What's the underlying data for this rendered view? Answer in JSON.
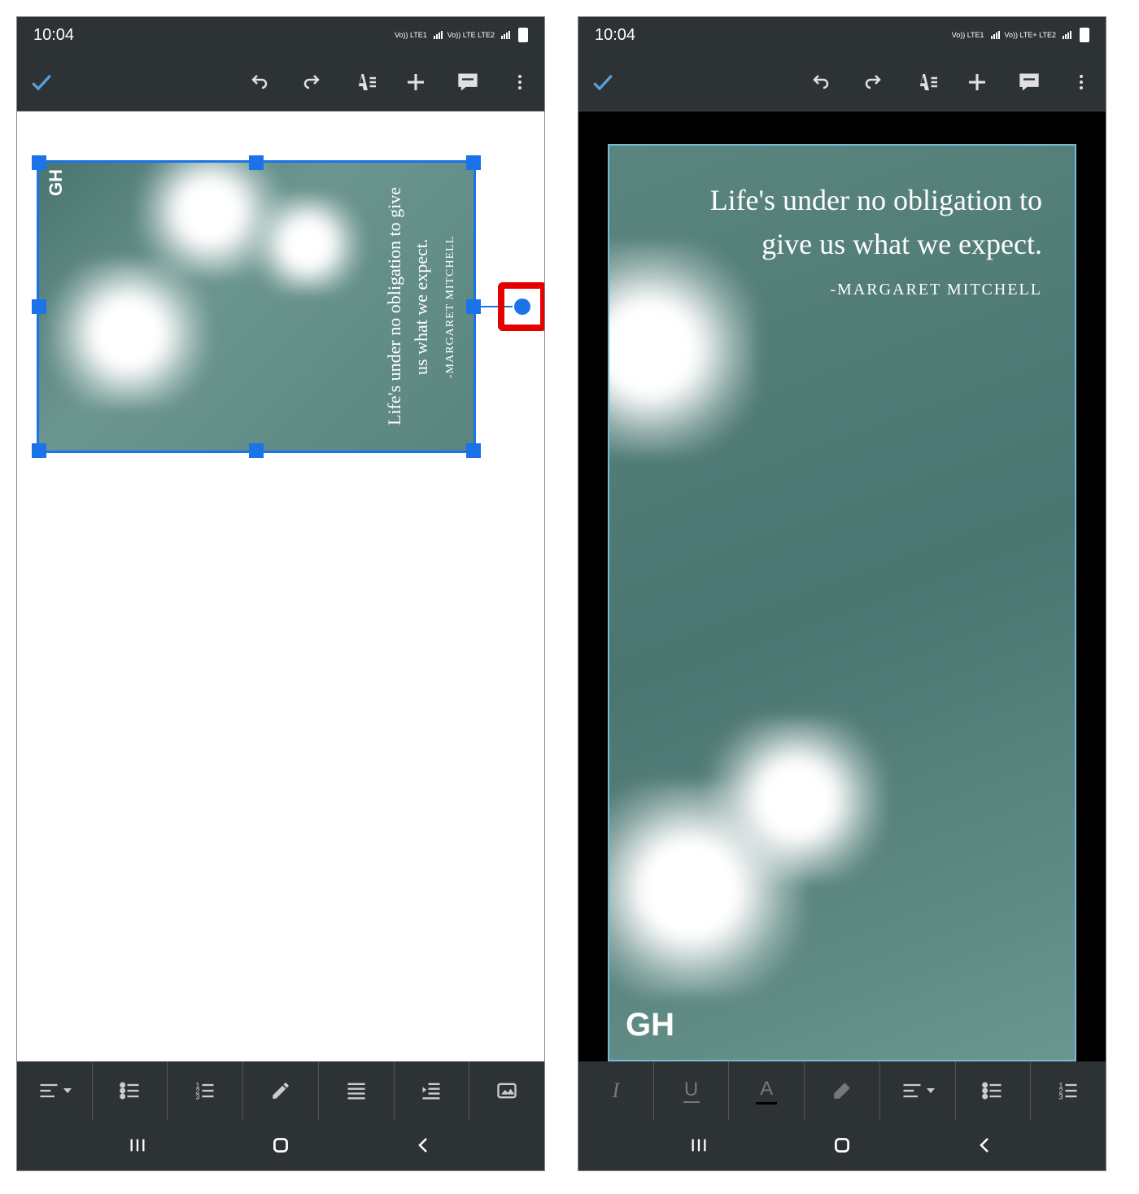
{
  "status": {
    "time": "10:04",
    "net1": "Vo)) LTE1",
    "net2": "Vo)) LTE LTE2",
    "net2b": "Vo)) LTE+ LTE2"
  },
  "image": {
    "quote": "Life's under no obligation to give us what we expect.",
    "author": "-MARGARET MITCHELL",
    "watermark": "GH"
  },
  "toolbar_icons": {
    "confirm": "confirm",
    "undo": "undo",
    "redo": "redo",
    "textformat": "text-format",
    "add": "add",
    "comment": "comment",
    "more": "more"
  },
  "fmt_left": [
    "align",
    "bullets",
    "numbers",
    "pencil",
    "justify",
    "indent",
    "image"
  ],
  "fmt_right": [
    "italic",
    "underline",
    "textcolor",
    "highlight",
    "align",
    "bullets",
    "numbers"
  ],
  "highlight": "rotation-handle"
}
